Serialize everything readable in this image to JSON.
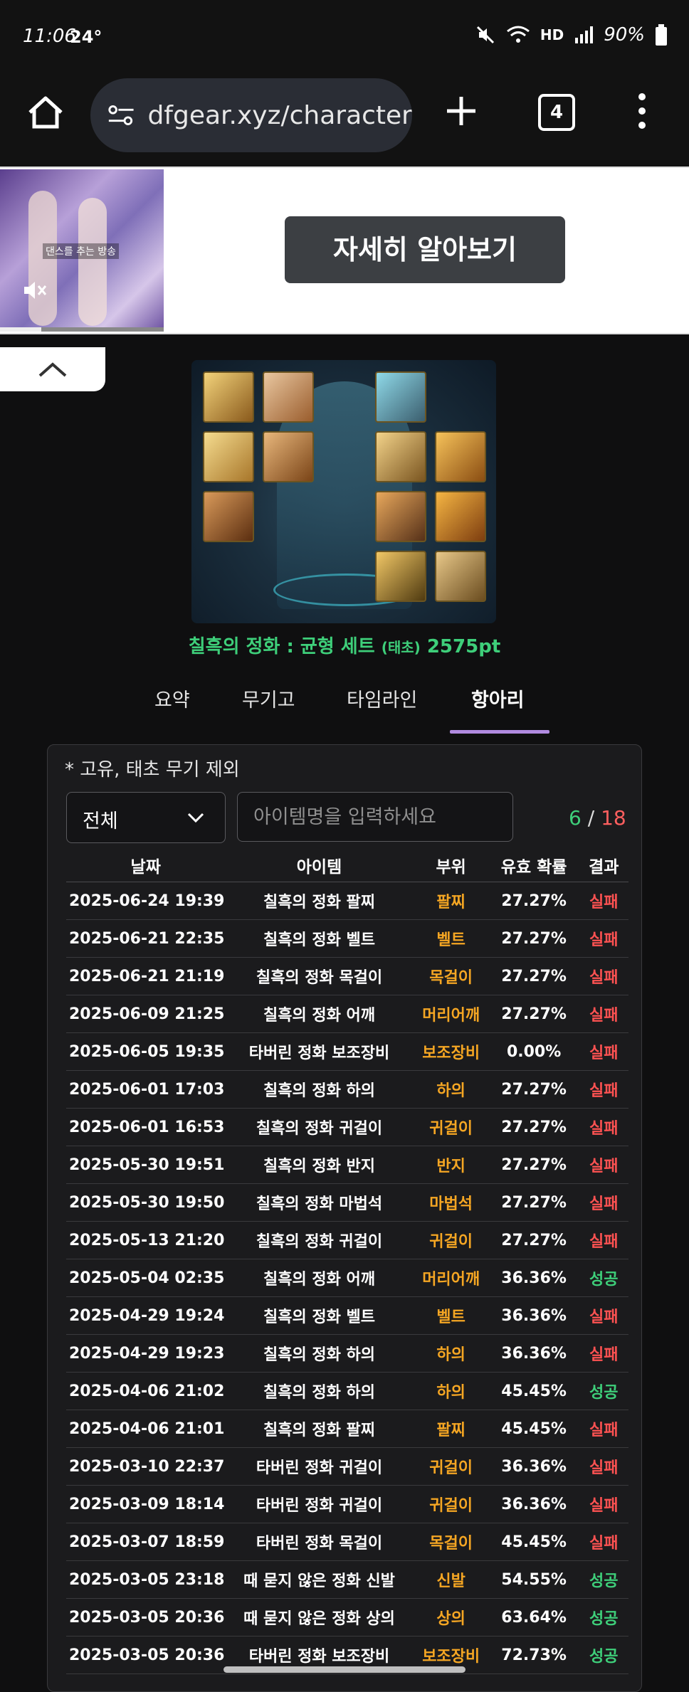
{
  "status_bar": {
    "time": "11:06",
    "temp": "24°",
    "network": "HD",
    "battery": "90%"
  },
  "browser": {
    "url": "dfgear.xyz/character",
    "tab_count": "4"
  },
  "ad": {
    "video_caption": "댄스를 추는 방송",
    "cta_label": "자세히 알아보기",
    "video_progress": 0.25
  },
  "character": {
    "set_title": "칠흑의 정화 : 균형 세트",
    "set_tag": "(태초)",
    "set_points": "2575pt"
  },
  "tabs": [
    {
      "label": "요약",
      "active": false
    },
    {
      "label": "무기고",
      "active": false
    },
    {
      "label": "타임라인",
      "active": false
    },
    {
      "label": "항아리",
      "active": true
    }
  ],
  "panel": {
    "note": "* 고유, 태초 무기 제외",
    "filter": {
      "selected": "전체"
    },
    "search": {
      "placeholder": "아이템명을 입력하세요"
    },
    "counter": {
      "success": "6",
      "separator": "/",
      "total": "18"
    },
    "columns": [
      "날짜",
      "아이템",
      "부위",
      "유효 확률",
      "결과"
    ],
    "rows": [
      {
        "date": "2025-06-24 19:39",
        "item": "칠흑의 정화 팔찌",
        "slot": "팔찌",
        "prob": "27.27%",
        "result": "실패"
      },
      {
        "date": "2025-06-21 22:35",
        "item": "칠흑의 정화 벨트",
        "slot": "벨트",
        "prob": "27.27%",
        "result": "실패"
      },
      {
        "date": "2025-06-21 21:19",
        "item": "칠흑의 정화 목걸이",
        "slot": "목걸이",
        "prob": "27.27%",
        "result": "실패"
      },
      {
        "date": "2025-06-09 21:25",
        "item": "칠흑의 정화 어깨",
        "slot": "머리어깨",
        "prob": "27.27%",
        "result": "실패"
      },
      {
        "date": "2025-06-05 19:35",
        "item": "타버린 정화 보조장비",
        "slot": "보조장비",
        "prob": "0.00%",
        "result": "실패"
      },
      {
        "date": "2025-06-01 17:03",
        "item": "칠흑의 정화 하의",
        "slot": "하의",
        "prob": "27.27%",
        "result": "실패"
      },
      {
        "date": "2025-06-01 16:53",
        "item": "칠흑의 정화 귀걸이",
        "slot": "귀걸이",
        "prob": "27.27%",
        "result": "실패"
      },
      {
        "date": "2025-05-30 19:51",
        "item": "칠흑의 정화 반지",
        "slot": "반지",
        "prob": "27.27%",
        "result": "실패"
      },
      {
        "date": "2025-05-30 19:50",
        "item": "칠흑의 정화 마법석",
        "slot": "마법석",
        "prob": "27.27%",
        "result": "실패"
      },
      {
        "date": "2025-05-13 21:20",
        "item": "칠흑의 정화 귀걸이",
        "slot": "귀걸이",
        "prob": "27.27%",
        "result": "실패"
      },
      {
        "date": "2025-05-04 02:35",
        "item": "칠흑의 정화 어깨",
        "slot": "머리어깨",
        "prob": "36.36%",
        "result": "성공"
      },
      {
        "date": "2025-04-29 19:24",
        "item": "칠흑의 정화 벨트",
        "slot": "벨트",
        "prob": "36.36%",
        "result": "실패"
      },
      {
        "date": "2025-04-29 19:23",
        "item": "칠흑의 정화 하의",
        "slot": "하의",
        "prob": "36.36%",
        "result": "실패"
      },
      {
        "date": "2025-04-06 21:02",
        "item": "칠흑의 정화 하의",
        "slot": "하의",
        "prob": "45.45%",
        "result": "성공"
      },
      {
        "date": "2025-04-06 21:01",
        "item": "칠흑의 정화 팔찌",
        "slot": "팔찌",
        "prob": "45.45%",
        "result": "실패"
      },
      {
        "date": "2025-03-10 22:37",
        "item": "타버린 정화 귀걸이",
        "slot": "귀걸이",
        "prob": "36.36%",
        "result": "실패"
      },
      {
        "date": "2025-03-09 18:14",
        "item": "타버린 정화 귀걸이",
        "slot": "귀걸이",
        "prob": "36.36%",
        "result": "실패"
      },
      {
        "date": "2025-03-07 18:59",
        "item": "타버린 정화 목걸이",
        "slot": "목걸이",
        "prob": "45.45%",
        "result": "실패"
      },
      {
        "date": "2025-03-05 23:18",
        "item": "때 묻지 않은 정화 신발",
        "slot": "신발",
        "prob": "54.55%",
        "result": "성공"
      },
      {
        "date": "2025-03-05 20:36",
        "item": "때 묻지 않은 정화 상의",
        "slot": "상의",
        "prob": "63.64%",
        "result": "성공"
      },
      {
        "date": "2025-03-05 20:36",
        "item": "타버린 정화 보조장비",
        "slot": "보조장비",
        "prob": "72.73%",
        "result": "성공"
      }
    ]
  },
  "colors": {
    "success": "#3ecf7a",
    "fail": "#ff5252",
    "slot": "#f5a623",
    "accent": "#b18be0",
    "background": "#0f0f10"
  },
  "icons": [
    "home-icon",
    "site-settings-icon",
    "plus-icon",
    "tabs-icon",
    "overflow-menu-icon",
    "mute-icon",
    "chevron-up-icon",
    "chevron-down-icon"
  ]
}
